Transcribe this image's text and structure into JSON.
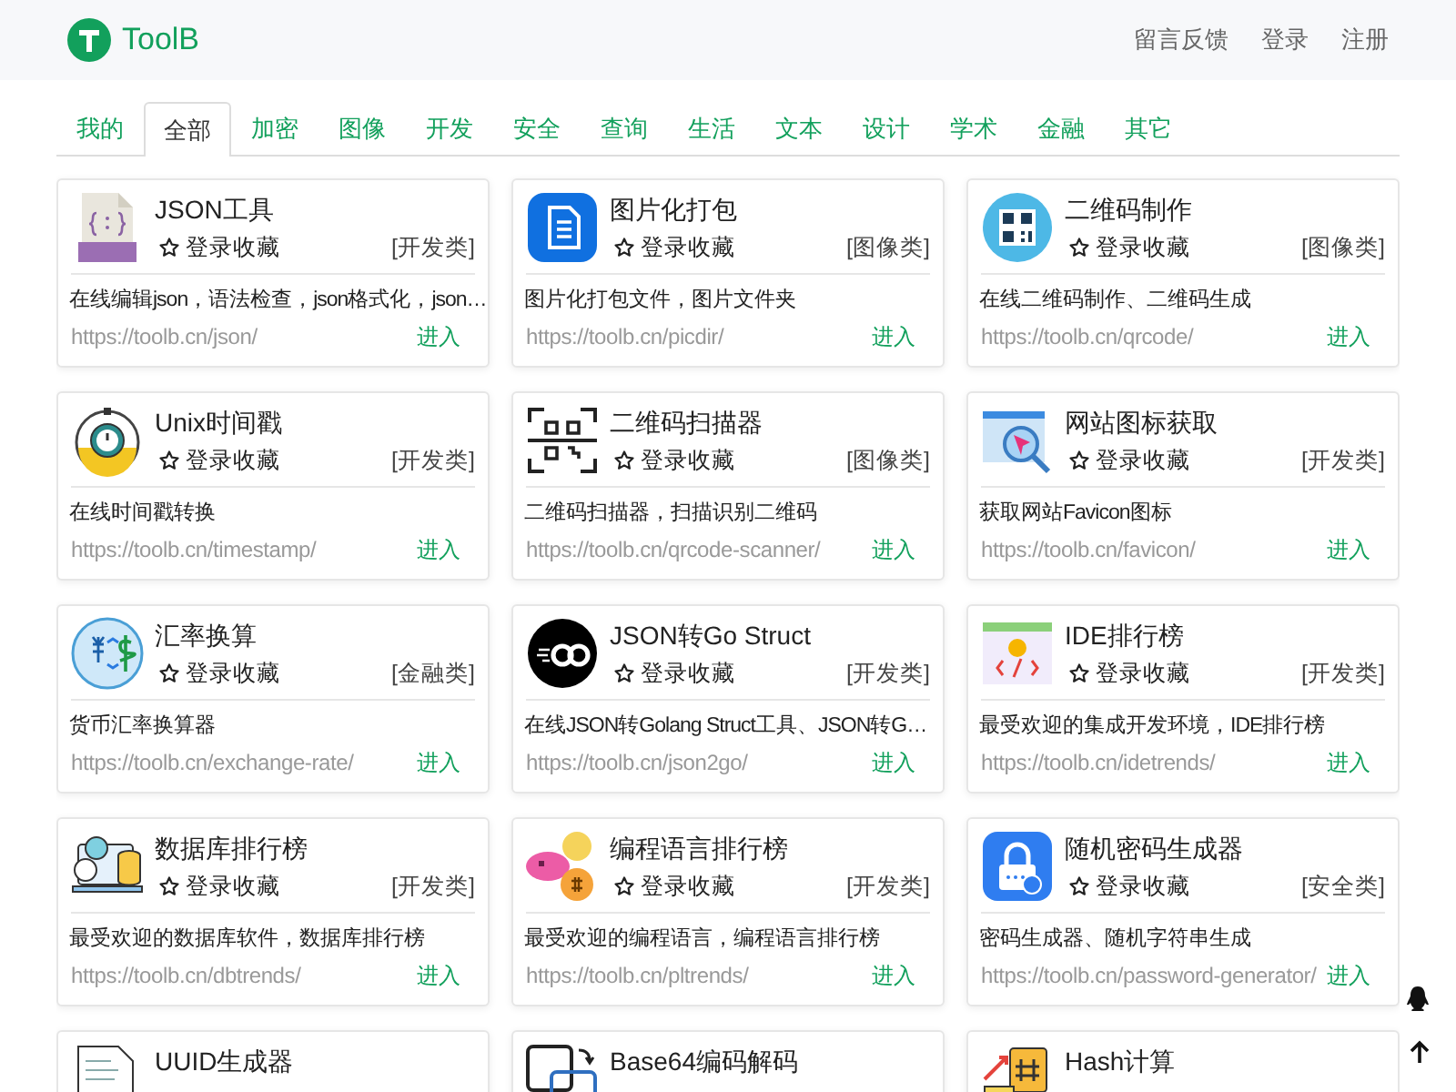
{
  "header": {
    "logo_text": "ToolB",
    "links": [
      "留言反馈",
      "登录",
      "注册"
    ]
  },
  "tabs": [
    {
      "label": "我的",
      "selected": false
    },
    {
      "label": "全部",
      "selected": true
    },
    {
      "label": "加密",
      "selected": false
    },
    {
      "label": "图像",
      "selected": false
    },
    {
      "label": "开发",
      "selected": false
    },
    {
      "label": "安全",
      "selected": false
    },
    {
      "label": "查询",
      "selected": false
    },
    {
      "label": "生活",
      "selected": false
    },
    {
      "label": "文本",
      "selected": false
    },
    {
      "label": "设计",
      "selected": false
    },
    {
      "label": "学术",
      "selected": false
    },
    {
      "label": "金融",
      "selected": false
    },
    {
      "label": "其它",
      "selected": false
    }
  ],
  "tools": [
    {
      "title": "JSON工具",
      "favorite": "登录收藏",
      "category": "[开发类]",
      "description": "在线编辑json，语法检查，json格式化，json…",
      "url": "https://toolb.cn/json/",
      "enter": "进入"
    },
    {
      "title": "图片化打包",
      "favorite": "登录收藏",
      "category": "[图像类]",
      "description": "图片化打包文件，图片文件夹",
      "url": "https://toolb.cn/picdir/",
      "enter": "进入"
    },
    {
      "title": "二维码制作",
      "favorite": "登录收藏",
      "category": "[图像类]",
      "description": "在线二维码制作、二维码生成",
      "url": "https://toolb.cn/qrcode/",
      "enter": "进入"
    },
    {
      "title": "Unix时间戳",
      "favorite": "登录收藏",
      "category": "[开发类]",
      "description": "在线时间戳转换",
      "url": "https://toolb.cn/timestamp/",
      "enter": "进入"
    },
    {
      "title": "二维码扫描器",
      "favorite": "登录收藏",
      "category": "[图像类]",
      "description": "二维码扫描器，扫描识别二维码",
      "url": "https://toolb.cn/qrcode-scanner/",
      "enter": "进入"
    },
    {
      "title": "网站图标获取",
      "favorite": "登录收藏",
      "category": "[开发类]",
      "description": "获取网站Favicon图标",
      "url": "https://toolb.cn/favicon/",
      "enter": "进入"
    },
    {
      "title": "汇率换算",
      "favorite": "登录收藏",
      "category": "[金融类]",
      "description": "货币汇率换算器",
      "url": "https://toolb.cn/exchange-rate/",
      "enter": "进入"
    },
    {
      "title": "JSON转Go Struct",
      "favorite": "登录收藏",
      "category": "[开发类]",
      "description": "在线JSON转Golang Struct工具、JSON转G…",
      "url": "https://toolb.cn/json2go/",
      "enter": "进入"
    },
    {
      "title": "IDE排行榜",
      "favorite": "登录收藏",
      "category": "[开发类]",
      "description": "最受欢迎的集成开发环境，IDE排行榜",
      "url": "https://toolb.cn/idetrends/",
      "enter": "进入"
    },
    {
      "title": "数据库排行榜",
      "favorite": "登录收藏",
      "category": "[开发类]",
      "description": "最受欢迎的数据库软件，数据库排行榜",
      "url": "https://toolb.cn/dbtrends/",
      "enter": "进入"
    },
    {
      "title": "编程语言排行榜",
      "favorite": "登录收藏",
      "category": "[开发类]",
      "description": "最受欢迎的编程语言，编程语言排行榜",
      "url": "https://toolb.cn/pltrends/",
      "enter": "进入"
    },
    {
      "title": "随机密码生成器",
      "favorite": "登录收藏",
      "category": "[安全类]",
      "description": "密码生成器、随机字符串生成",
      "url": "https://toolb.cn/password-generator/",
      "enter": "进入"
    },
    {
      "title": "UUID生成器"
    },
    {
      "title": "Base64编码解码"
    },
    {
      "title": "Hash计算"
    }
  ]
}
